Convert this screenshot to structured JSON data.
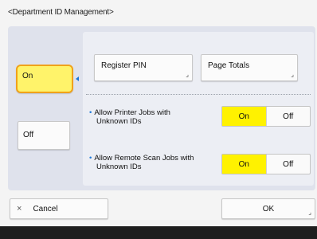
{
  "page": {
    "title": "<Department ID Management>"
  },
  "main_toggle": {
    "on_label": "On",
    "off_label": "Off",
    "selected": "On"
  },
  "sub_buttons": {
    "register_pin": "Register PIN",
    "page_totals": "Page Totals"
  },
  "settings": [
    {
      "label_line1": "Allow Printer Jobs with",
      "label_line2": "Unknown IDs",
      "on_label": "On",
      "off_label": "Off",
      "selected": "On"
    },
    {
      "label_line1": "Allow Remote Scan Jobs with",
      "label_line2": "Unknown IDs",
      "on_label": "On",
      "off_label": "Off",
      "selected": "On"
    }
  ],
  "footer_buttons": {
    "cancel": "Cancel",
    "cancel_icon": "×",
    "ok": "OK"
  },
  "icons": {
    "bullet": "•",
    "corner_arrow": "⌟"
  },
  "colors": {
    "selected": "#fff200",
    "focus_border": "#f0a21a",
    "accent": "#1c78d8"
  }
}
